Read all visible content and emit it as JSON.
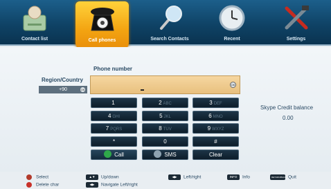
{
  "tabs": [
    {
      "label": "Contact list",
      "icon": "contact-list-icon",
      "active": false
    },
    {
      "label": "Call phones",
      "icon": "telephone-icon",
      "active": true
    },
    {
      "label": "Search Contacts",
      "icon": "magnifier-icon",
      "active": false
    },
    {
      "label": "Recent",
      "icon": "clock-icon",
      "active": false
    },
    {
      "label": "Settings",
      "icon": "tools-icon",
      "active": false
    }
  ],
  "region": {
    "label": "Region/Country",
    "value": "+90",
    "ok_glyph": "OK"
  },
  "phone": {
    "label": "Phone number",
    "value": "",
    "ok_glyph": "OK"
  },
  "keypad": {
    "keys": [
      {
        "main": "1",
        "sub": ""
      },
      {
        "main": "2",
        "sub": "ABC"
      },
      {
        "main": "3",
        "sub": "DEF"
      },
      {
        "main": "4",
        "sub": "GHI"
      },
      {
        "main": "5",
        "sub": "JKL"
      },
      {
        "main": "6",
        "sub": "MNO"
      },
      {
        "main": "7",
        "sub": "PQRS"
      },
      {
        "main": "8",
        "sub": "TUV"
      },
      {
        "main": "9",
        "sub": "WXYZ"
      },
      {
        "main": "*",
        "sub": ""
      },
      {
        "main": "0",
        "sub": ""
      },
      {
        "main": "#",
        "sub": ""
      }
    ],
    "call_label": "Call",
    "sms_label": "SMS",
    "clear_label": "Clear"
  },
  "credit": {
    "label": "Skype Credit balance",
    "value": "0.00"
  },
  "footer": {
    "select": "Select",
    "delete": "Delete char",
    "updown": "Up/down",
    "navigate": "Navigate Left/right",
    "leftright": "Left/right",
    "info_key": "INFO",
    "info": "Info",
    "return_key": "RETURN/BACK",
    "quit": "Quit"
  },
  "colors": {
    "active_tab": "#f3a311",
    "call_green": "#2fa84a",
    "accent_blue": "#0f4366"
  }
}
